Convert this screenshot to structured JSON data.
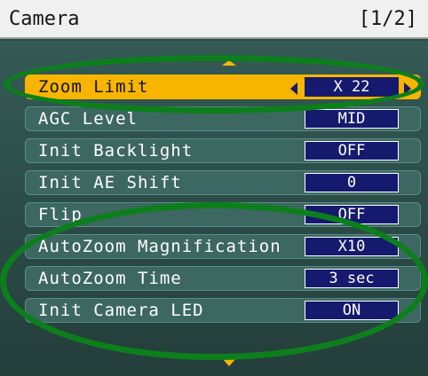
{
  "header": {
    "title": "Camera",
    "page_indicator": "[1/2]"
  },
  "menu": {
    "scroll_up_icon": "triangle-up-icon",
    "scroll_down_icon": "triangle-down-icon",
    "items": [
      {
        "label": "Zoom Limit",
        "value": "X 22",
        "selected": true
      },
      {
        "label": "AGC Level",
        "value": "MID"
      },
      {
        "label": "Init Backlight",
        "value": "OFF"
      },
      {
        "label": "Init AE Shift",
        "value": "0"
      },
      {
        "label": "Flip",
        "value": "OFF"
      },
      {
        "label": "AutoZoom Magnification",
        "value": "X10"
      },
      {
        "label": "AutoZoom Time",
        "value": "3 sec"
      },
      {
        "label": "Init Camera LED",
        "value": "ON"
      }
    ]
  },
  "colors": {
    "background": "#2c4a45",
    "row": "#3d6761",
    "selected_row": "#f7b500",
    "value_box": "#151a6e",
    "highlight_ring": "#0c7f1c"
  }
}
